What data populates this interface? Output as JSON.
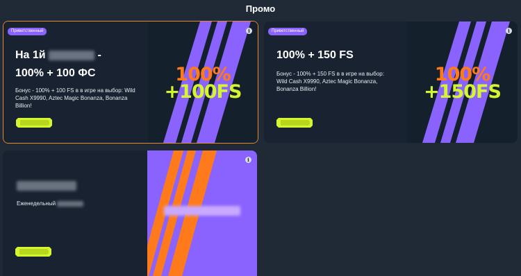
{
  "page": {
    "title": "Промо"
  },
  "colors": {
    "accent_purple": "#8a63ff",
    "accent_orange": "#ff7a1a",
    "accent_lime": "#d4f530",
    "selected_border": "#e8892e"
  },
  "cards": [
    {
      "badge": "Приветственный",
      "title_line1": "На 1й",
      "title_line1_suffix": "-",
      "title_line2": "100% + 100 ФС",
      "description": "Бонус - 100% + 100 FS в в игре на выбор: Wild Cash X9990, Aztec Magic Bonanza, Bonanza Billion!",
      "banner_line1": "100%",
      "banner_line2": "+100FS",
      "selected": true
    },
    {
      "badge": "Приветственный",
      "title": "100% + 150 FS",
      "description": "Бонус - 100% + 150 FS в в игре на выбор: Wild Cash X9990, Aztec Magic Bonanza, Bonanza Billion!",
      "banner_line1": "100%",
      "banner_line2": "+150FS"
    },
    {
      "description": "Еженедельный"
    }
  ],
  "icons": {
    "info": "info-icon",
    "cta": "cta-button-shape"
  }
}
